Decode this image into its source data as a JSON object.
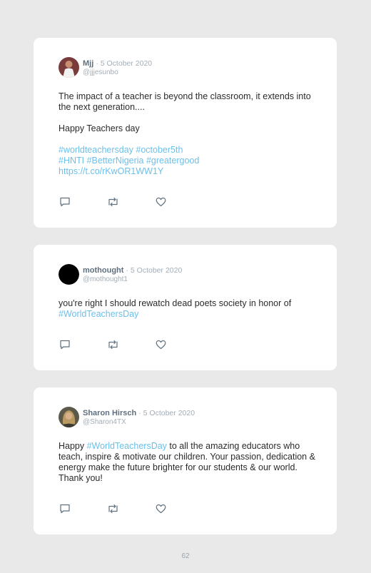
{
  "tweets": [
    {
      "name": "Mjj",
      "date": "· 5 October 2020",
      "handle": "@jjjesunbo",
      "text1": "The impact of a teacher is beyond the classroom, it extends into the next generation....",
      "text2": "Happy Teachers day",
      "tags1": "#worldteachersday #october5th",
      "tags2": "#HNTI #BetterNigeria #greatergood",
      "url": "https://t.co/rKwOR1WW1Y"
    },
    {
      "name": "mothought",
      "date": "· 5 October 2020",
      "handle": "@mothought1",
      "text1": "you're right I should rewatch dead poets society in honor of",
      "tag": "#WorldTeachersDay"
    },
    {
      "name": "Sharon Hirsch",
      "date": "· 5 October 2020",
      "handle": "@Sharon4TX",
      "pre": "Happy ",
      "tag": "#WorldTeachersDay",
      "post": " to all the amazing educators who teach, inspire & motivate our children. Your passion, dedication & energy make the future brighter for our students & our world. Thank you!"
    }
  ],
  "icons": [
    "reply-icon",
    "retweet-icon",
    "like-icon"
  ],
  "colors": {
    "link": "#6cc0ea",
    "name": "#5f6f7e",
    "muted": "#a3adb6",
    "background": "#e9e9ea"
  },
  "page_number": "62"
}
